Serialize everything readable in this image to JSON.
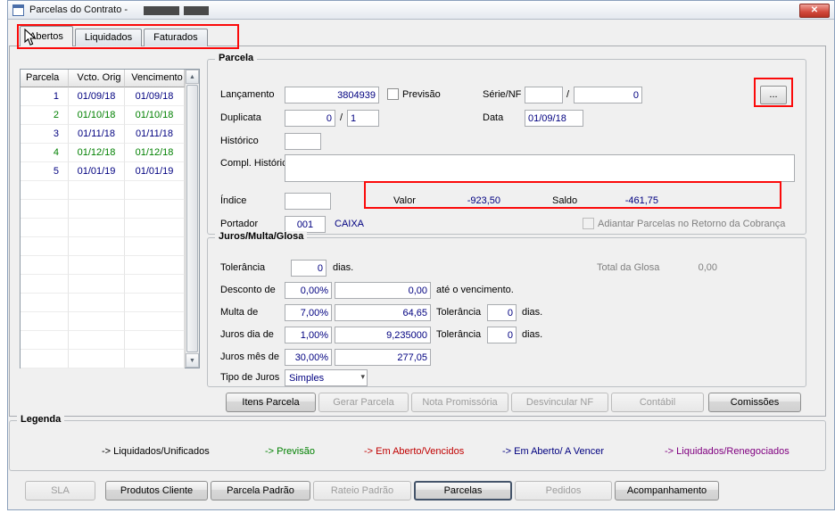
{
  "window": {
    "title": "Parcelas do Contrato -"
  },
  "icons": {
    "close": "✕",
    "scroll_up": "▲",
    "scroll_down": "▼",
    "combo_arrow": "▾"
  },
  "tabs": [
    {
      "label": "Abertos",
      "active": true
    },
    {
      "label": "Liquidados",
      "active": false
    },
    {
      "label": "Faturados",
      "active": false
    }
  ],
  "table": {
    "columns": [
      "Parcela",
      "Vcto. Orig",
      "Vencimento"
    ],
    "rows": [
      {
        "parcela": "1",
        "vcto": "01/09/18",
        "venc": "01/09/18",
        "color": "#000080"
      },
      {
        "parcela": "2",
        "vcto": "01/10/18",
        "venc": "01/10/18",
        "color": "#008000"
      },
      {
        "parcela": "3",
        "vcto": "01/11/18",
        "venc": "01/11/18",
        "color": "#000080"
      },
      {
        "parcela": "4",
        "vcto": "01/12/18",
        "venc": "01/12/18",
        "color": "#008000"
      },
      {
        "parcela": "5",
        "vcto": "01/01/19",
        "venc": "01/01/19",
        "color": "#000080"
      }
    ]
  },
  "parcela": {
    "group_title": "Parcela",
    "lancamento_label": "Lançamento",
    "lancamento_value": "3804939",
    "previsao_label": "Previsão",
    "serie_label": "Série/NF",
    "serie_value": "",
    "slash": "/",
    "nf_value": "0",
    "browse_label": "...",
    "duplicata_label": "Duplicata",
    "duplicata_value": "0",
    "duplicata_seq": "1",
    "data_label": "Data",
    "data_value": "01/09/18",
    "historico_label": "Histórico",
    "historico_value": "",
    "compl_historico_label": "Compl. Histórico",
    "compl_historico_value": "",
    "indice_label": "Índice",
    "indice_value": "",
    "valor_label": "Valor",
    "valor_value": "-923,50",
    "saldo_label": "Saldo",
    "saldo_value": "-461,75",
    "portador_label": "Portador",
    "portador_value": "001",
    "portador_desc": "CAIXA",
    "adiantar_label": "Adiantar Parcelas no Retorno da Cobrança"
  },
  "juros": {
    "group_title": "Juros/Multa/Glosa",
    "tolerancia_label": "Tolerância",
    "tolerancia_value": "0",
    "dias_label": "dias.",
    "total_glosa_label": "Total da Glosa",
    "total_glosa_value": "0,00",
    "desconto_label": "Desconto de",
    "desconto_pct": "0,00%",
    "desconto_value": "0,00",
    "ate_vencimento_label": "até o vencimento.",
    "multa_label": "Multa de",
    "multa_pct": "7,00%",
    "multa_value": "64,65",
    "multa_tolerancia_label": "Tolerância",
    "multa_tolerancia_value": "0",
    "multa_dias_label": "dias.",
    "juros_dia_label": "Juros dia de",
    "juros_dia_pct": "1,00%",
    "juros_dia_value": "9,235000",
    "juros_dia_tolerancia_label": "Tolerância",
    "juros_dia_tolerancia_value": "0",
    "juros_dia_dias_label": "dias.",
    "juros_mes_label": "Juros mês de",
    "juros_mes_pct": "30,00%",
    "juros_mes_value": "277,05",
    "tipo_juros_label": "Tipo de Juros",
    "tipo_juros_value": "Simples"
  },
  "actions": [
    {
      "label": "Itens Parcela",
      "enabled": true
    },
    {
      "label": "Gerar Parcela",
      "enabled": false
    },
    {
      "label": "Nota Promissória",
      "enabled": false
    },
    {
      "label": "Desvincular NF",
      "enabled": false
    },
    {
      "label": "Contábil",
      "enabled": false
    },
    {
      "label": "Comissões",
      "enabled": true
    }
  ],
  "legend": {
    "group_title": "Legenda",
    "items": [
      {
        "label": "-> Liquidados/Unificados",
        "color": "#000000"
      },
      {
        "label": "-> Previsão",
        "color": "#008000"
      },
      {
        "label": "-> Em Aberto/Vencidos",
        "color": "#c00000"
      },
      {
        "label": "-> Em Aberto/ A Vencer",
        "color": "#000080"
      },
      {
        "label": "-> Liquidados/Renegociados",
        "color": "#800080"
      }
    ]
  },
  "bottom_bar": [
    {
      "label": "SLA",
      "enabled": false,
      "active": false
    },
    {
      "label": "Produtos Cliente",
      "enabled": true,
      "active": false
    },
    {
      "label": "Parcela Padrão",
      "enabled": true,
      "active": false
    },
    {
      "label": "Rateio Padrão",
      "enabled": false,
      "active": false
    },
    {
      "label": "Parcelas",
      "enabled": true,
      "active": true
    },
    {
      "label": "Pedidos",
      "enabled": false,
      "active": false
    },
    {
      "label": "Acompanhamento",
      "enabled": true,
      "active": false
    }
  ]
}
